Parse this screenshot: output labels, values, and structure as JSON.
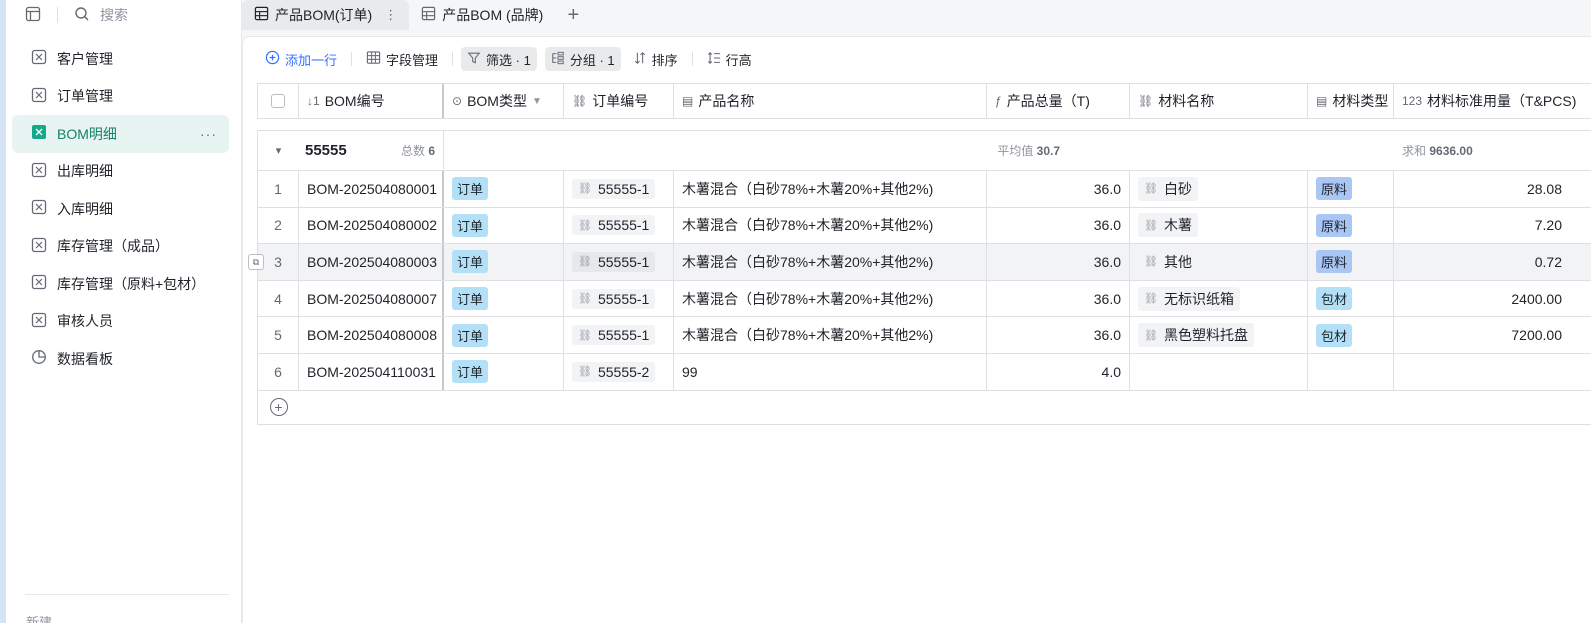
{
  "sidebar": {
    "search_placeholder": "搜索",
    "items": [
      {
        "label": "客户管理",
        "icon": "table-icon"
      },
      {
        "label": "订单管理",
        "icon": "table-icon"
      },
      {
        "label": "BOM明细",
        "icon": "table-icon",
        "active": true,
        "more": "···"
      },
      {
        "label": "出库明细",
        "icon": "table-icon"
      },
      {
        "label": "入库明细",
        "icon": "table-icon"
      },
      {
        "label": "库存管理（成品）",
        "icon": "table-icon"
      },
      {
        "label": "库存管理（原料+包材）",
        "icon": "table-icon"
      },
      {
        "label": "审核人员",
        "icon": "table-icon"
      },
      {
        "label": "数据看板",
        "icon": "pie-chart-icon"
      }
    ],
    "bottom_text": "新建"
  },
  "tabs": [
    {
      "label": "产品BOM(订单)",
      "active": true,
      "more": "⋮"
    },
    {
      "label": "产品BOM (品牌)",
      "active": false
    }
  ],
  "tab_add": "+",
  "toolbar": {
    "add_row": "添加一行",
    "fields": "字段管理",
    "filter": "筛选 · 1",
    "group": "分组 · 1",
    "sort": "排序",
    "row_height": "行高"
  },
  "columns": [
    {
      "label": "BOM编号",
      "icon": "↓1"
    },
    {
      "label": "BOM类型",
      "icon": "⊙",
      "filter": "▼"
    },
    {
      "label": "订单编号",
      "icon": "⛓"
    },
    {
      "label": "产品名称",
      "icon": "▤"
    },
    {
      "label": "产品总量（T)",
      "icon": "ƒ"
    },
    {
      "label": "材料名称",
      "icon": "⛓"
    },
    {
      "label": "材料类型",
      "icon": "▤"
    },
    {
      "label": "材料标准用量（T&PCS)",
      "icon": "123"
    }
  ],
  "group": {
    "name": "55555",
    "count_label": "总数",
    "count": "6",
    "avg_label": "平均值",
    "avg_value": "30.7",
    "sum_label": "求和",
    "sum_value": "9636.00"
  },
  "rows": [
    {
      "num": "1",
      "bom": "BOM-202504080001",
      "type": "订单",
      "order": "55555-1",
      "product": "木薯混合（白砂78%+木薯20%+其他2%)",
      "total": "36.0",
      "material": "白砂",
      "mtype": "原料",
      "qty": "28.08"
    },
    {
      "num": "2",
      "bom": "BOM-202504080002",
      "type": "订单",
      "order": "55555-1",
      "product": "木薯混合（白砂78%+木薯20%+其他2%)",
      "total": "36.0",
      "material": "木薯",
      "mtype": "原料",
      "qty": "7.20"
    },
    {
      "num": "3",
      "bom": "BOM-202504080003",
      "type": "订单",
      "order": "55555-1",
      "product": "木薯混合（白砂78%+木薯20%+其他2%)",
      "total": "36.0",
      "material": "其他",
      "mtype": "原料",
      "qty": "0.72"
    },
    {
      "num": "4",
      "bom": "BOM-202504080007",
      "type": "订单",
      "order": "55555-1",
      "product": "木薯混合（白砂78%+木薯20%+其他2%)",
      "total": "36.0",
      "material": "无标识纸箱",
      "mtype": "包材",
      "qty": "2400.00"
    },
    {
      "num": "5",
      "bom": "BOM-202504080008",
      "type": "订单",
      "order": "55555-1",
      "product": "木薯混合（白砂78%+木薯20%+其他2%)",
      "total": "36.0",
      "material": "黑色塑料托盘",
      "mtype": "包材",
      "qty": "7200.00"
    },
    {
      "num": "6",
      "bom": "BOM-202504110031",
      "type": "订单",
      "order": "55555-2",
      "product": "99",
      "total": "4.0",
      "material": "",
      "mtype": "",
      "qty": ""
    }
  ],
  "add_row_icon": "+",
  "group_toggle": "▾"
}
